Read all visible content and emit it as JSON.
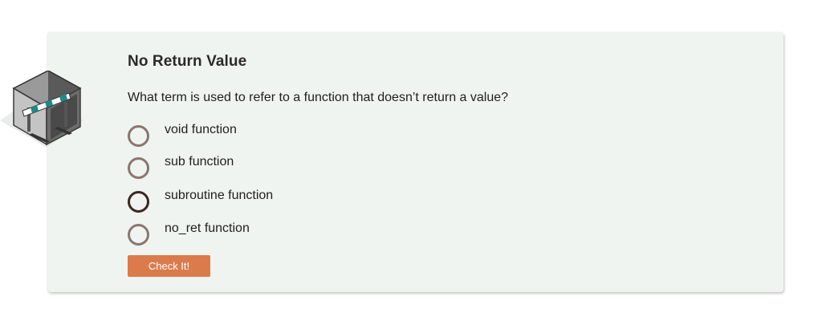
{
  "quiz": {
    "icon": "barrier-gate-box-icon",
    "title": "No Return Value",
    "question": "What term is used to refer to a function that doesn’t return a value?",
    "options": [
      {
        "label": "void function"
      },
      {
        "label": "sub function"
      },
      {
        "label": "subroutine function"
      },
      {
        "label": "no_ret function"
      }
    ],
    "submit_label": "Check It!"
  },
  "colors": {
    "card_background": "#eff4f0",
    "radio_border": "#8a7670",
    "radio_border_focused": "#3f2622",
    "button_background": "#db7b4c"
  }
}
